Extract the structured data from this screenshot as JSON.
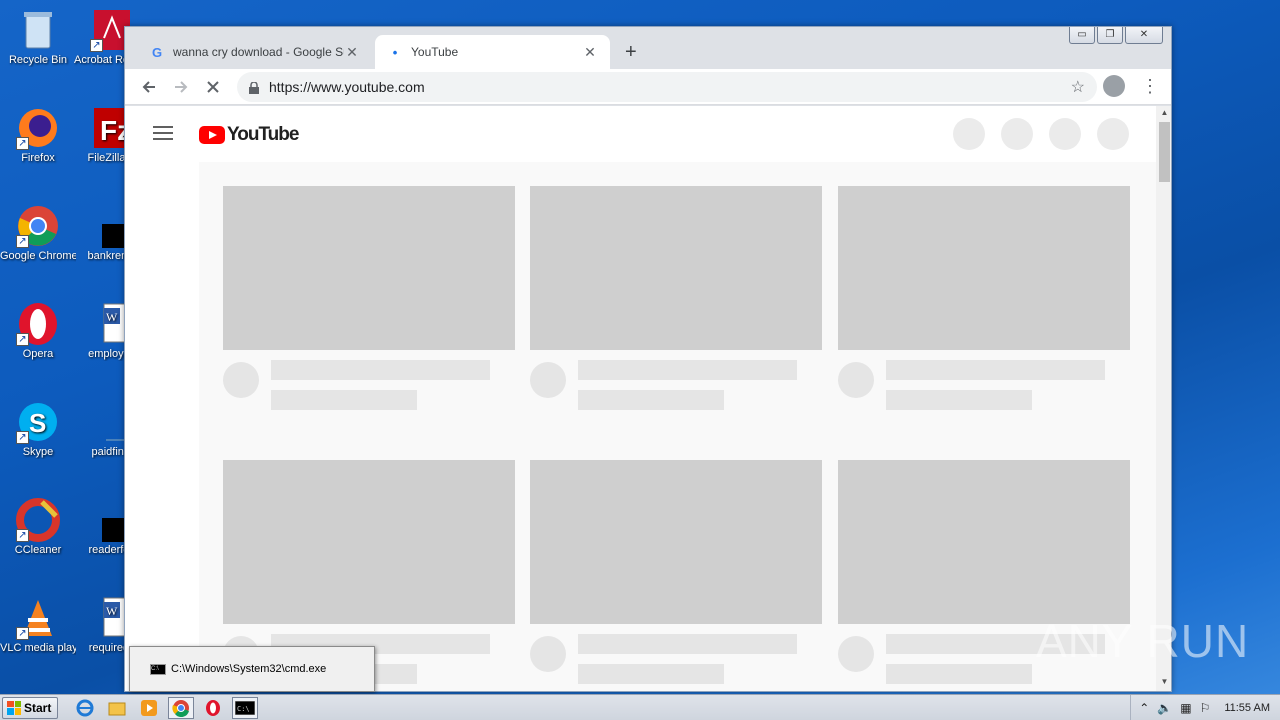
{
  "desktop": {
    "icons": [
      {
        "label": "Recycle Bin",
        "icon": "recycle-bin-icon"
      },
      {
        "label": "Acrobat Reader",
        "icon": "acrobat-icon"
      },
      {
        "label": "Firefox",
        "icon": "firefox-icon"
      },
      {
        "label": "FileZilla C",
        "icon": "filezilla-icon"
      },
      {
        "label": "Google Chrome",
        "icon": "chrome-icon"
      },
      {
        "label": "bankrenta",
        "icon": "black-file-icon"
      },
      {
        "label": "Opera",
        "icon": "opera-icon"
      },
      {
        "label": "employee",
        "icon": "word-doc-icon"
      },
      {
        "label": "Skype",
        "icon": "skype-icon"
      },
      {
        "label": "paidfinal",
        "icon": "blank-file-icon"
      },
      {
        "label": "CCleaner",
        "icon": "ccleaner-icon"
      },
      {
        "label": "readerfee",
        "icon": "black-file-icon"
      },
      {
        "label": "VLC media player",
        "icon": "vlc-icon"
      },
      {
        "label": "requiredb",
        "icon": "word-doc-icon"
      }
    ]
  },
  "browser": {
    "tabs": [
      {
        "title": "wanna cry download - Google Suche",
        "favicon": "G",
        "close": "✕"
      },
      {
        "title": "YouTube",
        "favicon": "•",
        "close": "✕"
      }
    ],
    "new_tab": "+",
    "address": {
      "url": "https://www.youtube.com"
    },
    "window_controls": {
      "minimize": "▭",
      "restore": "❐",
      "close": "✕"
    }
  },
  "youtube": {
    "logo_text": "YouTube"
  },
  "taskbar": {
    "start_label": "Start",
    "popup_label": "C:\\Windows\\System32\\cmd.exe",
    "clock": "11:55 AM"
  },
  "watermark": "ANY RUN",
  "colors": {
    "youtube_red": "#ff0000",
    "desktop_blue": "#0d5bbd",
    "placeholder_gray": "#cfcfcf"
  }
}
